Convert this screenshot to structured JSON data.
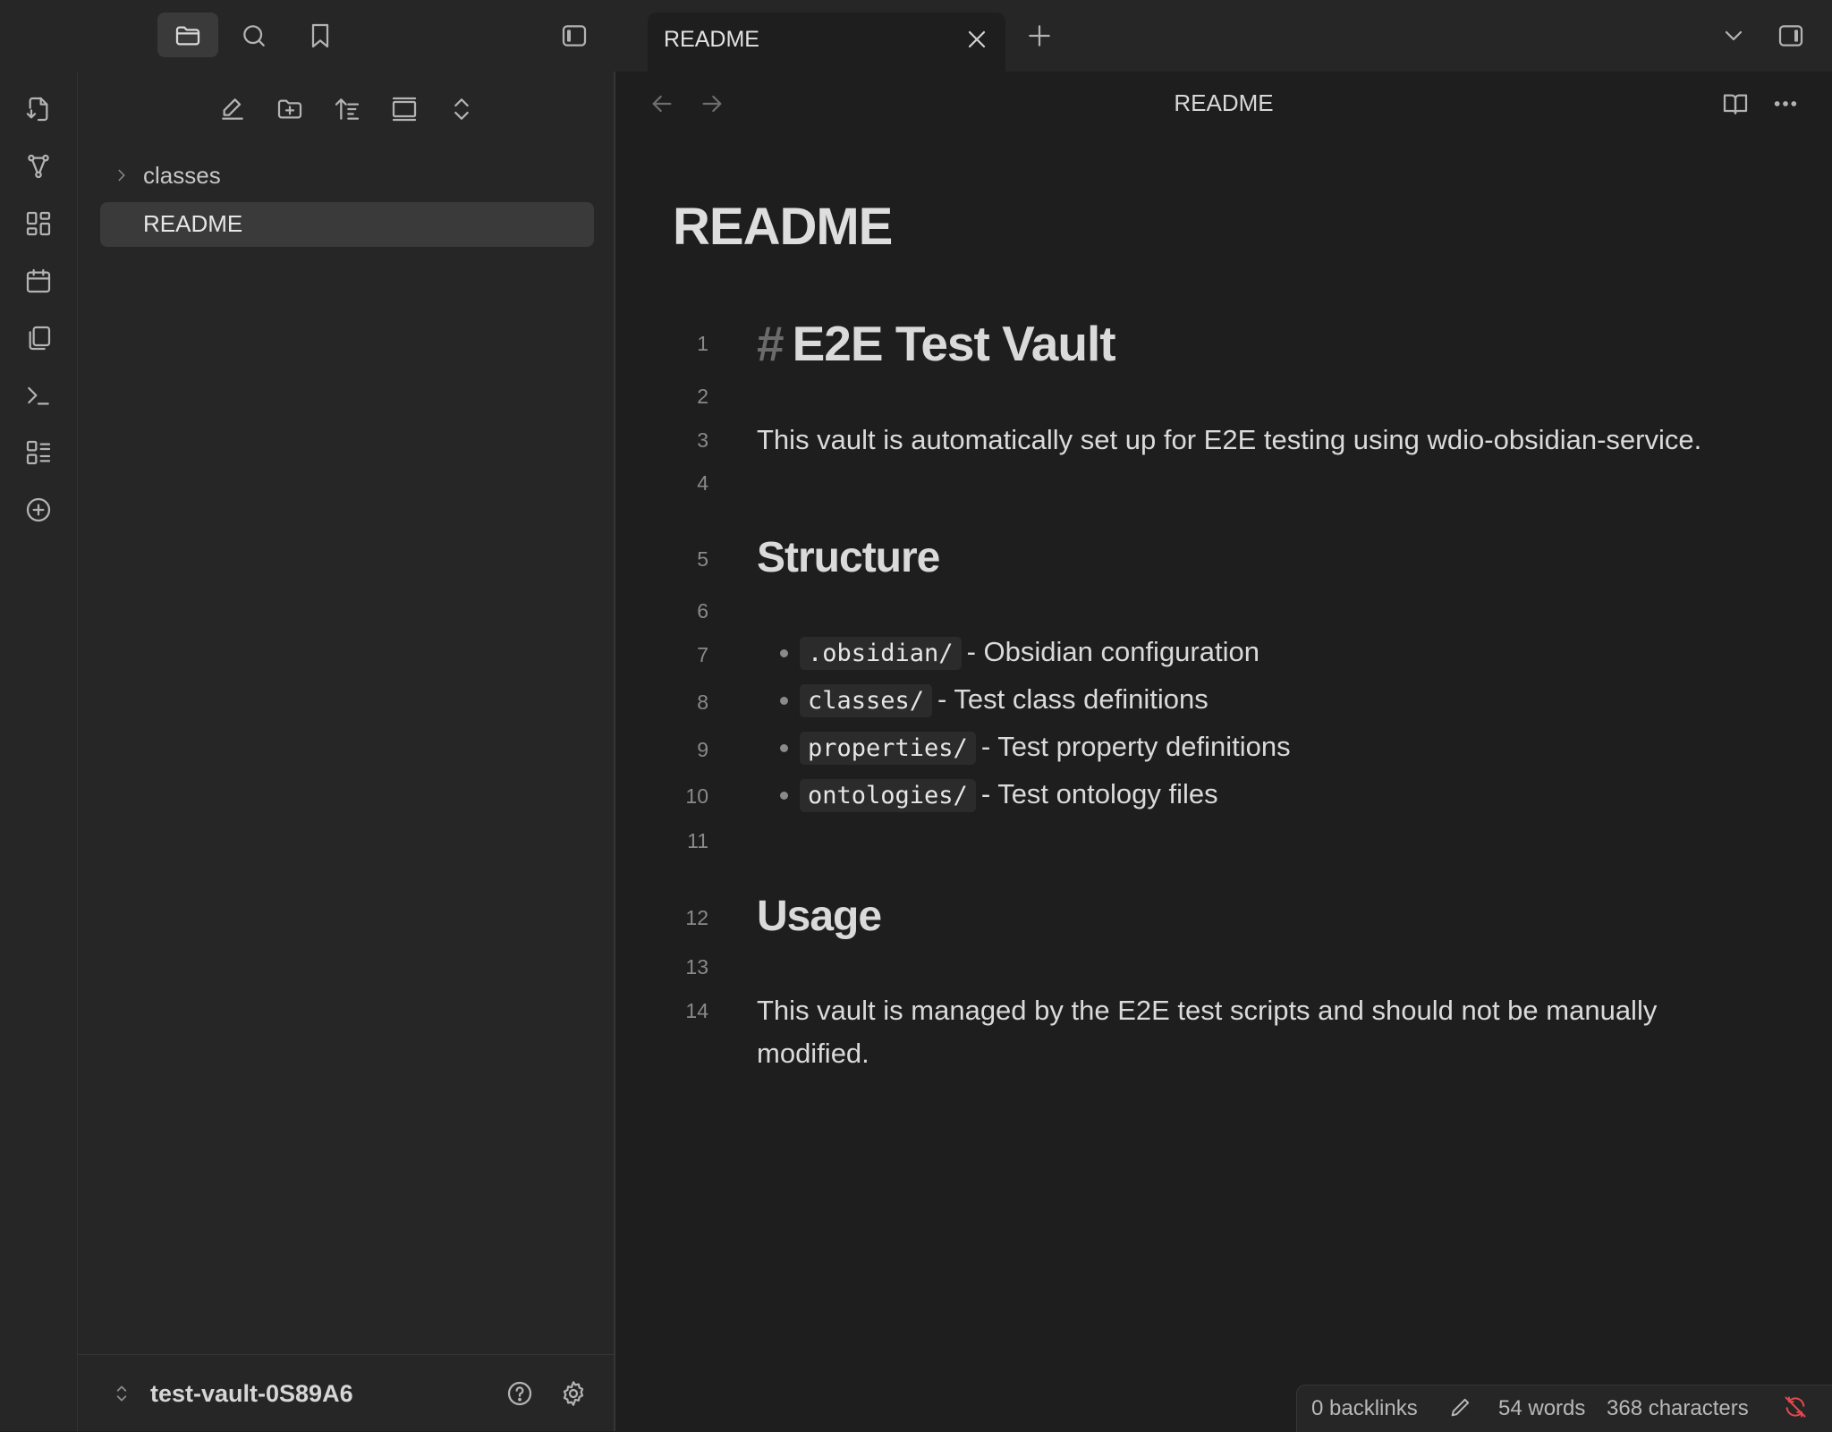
{
  "tabs": [
    {
      "label": "README"
    }
  ],
  "view_header": {
    "title": "README"
  },
  "file_tree": {
    "items": [
      {
        "label": "classes",
        "type": "folder"
      },
      {
        "label": "README",
        "type": "file"
      }
    ]
  },
  "vault": {
    "name": "test-vault-0S89A6"
  },
  "note": {
    "inline_title": "README",
    "line_numbers": [
      "1",
      "2",
      "3",
      "4",
      "5",
      "6",
      "7",
      "8",
      "9",
      "10",
      "11",
      "12",
      "13",
      "14"
    ],
    "h1": {
      "hash": "#",
      "text": "E2E Test Vault"
    },
    "intro": "This vault is automatically set up for E2E testing using wdio-obsidian-service.",
    "structure_heading": "Structure",
    "structure_items": [
      {
        "code": ".obsidian/",
        "text": "- Obsidian configuration"
      },
      {
        "code": "classes/",
        "text": "- Test class definitions"
      },
      {
        "code": "properties/",
        "text": "- Test property definitions"
      },
      {
        "code": "ontologies/",
        "text": "- Test ontology files"
      }
    ],
    "usage_heading": "Usage",
    "usage_line1": "This vault is managed by the E2E test scripts and should not be manually",
    "usage_line2": "modified."
  },
  "status_bar": {
    "backlinks": "0 backlinks",
    "words": "54 words",
    "characters": "368 characters"
  },
  "colors": {
    "background": "#1e1e1e",
    "panel": "#262626",
    "sync_error": "#e5484d"
  },
  "icons": [
    "files-icon",
    "search-icon",
    "bookmark-icon",
    "sidebar-toggle-icon",
    "close-icon",
    "plus-icon",
    "chevron-down-icon",
    "right-sidebar-icon",
    "switcher-icon",
    "graph-icon",
    "canvas-icon",
    "calendar-icon",
    "templates-icon",
    "terminal-icon",
    "bases-icon",
    "add-icon",
    "new-note-icon",
    "new-folder-icon",
    "sort-icon",
    "collapse-icon",
    "expand-icon",
    "back-icon",
    "forward-icon",
    "reading-view-icon",
    "more-icon",
    "help-icon",
    "settings-icon",
    "pencil-icon",
    "sync-off-icon"
  ]
}
